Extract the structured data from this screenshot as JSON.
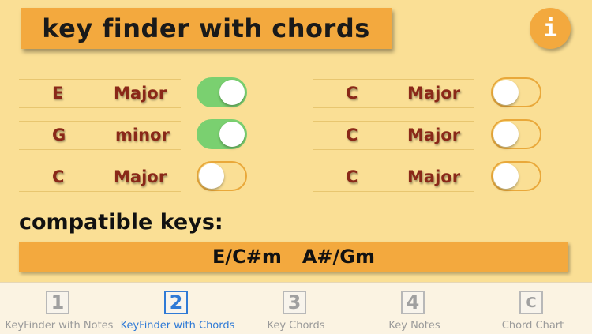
{
  "header": {
    "title": "key finder with chords",
    "info_label": "i"
  },
  "chord_rows": [
    {
      "note": "E",
      "mode": "Major",
      "enabled": true
    },
    {
      "note": "G",
      "mode": "minor",
      "enabled": true
    },
    {
      "note": "C",
      "mode": "Major",
      "enabled": false
    },
    {
      "note": "C",
      "mode": "Major",
      "enabled": false
    },
    {
      "note": "C",
      "mode": "Major",
      "enabled": false
    },
    {
      "note": "C",
      "mode": "Major",
      "enabled": false
    }
  ],
  "compatible": {
    "label": "compatible keys:",
    "keys": [
      "E/C#m",
      "A#/Gm"
    ]
  },
  "tabs": [
    {
      "icon": "1",
      "label": "KeyFinder with Notes",
      "active": false
    },
    {
      "icon": "2",
      "label": "KeyFinder with Chords",
      "active": true
    },
    {
      "icon": "3",
      "label": "Key Chords",
      "active": false
    },
    {
      "icon": "4",
      "label": "Key Notes",
      "active": false
    },
    {
      "icon": "C",
      "label": "Chord Chart",
      "active": false
    }
  ],
  "colors": {
    "background": "#fadf95",
    "banner": "#f3a93e",
    "toggle_on": "#7ad070",
    "chord_text": "#8a2818",
    "active_tab": "#2f7ad6"
  }
}
